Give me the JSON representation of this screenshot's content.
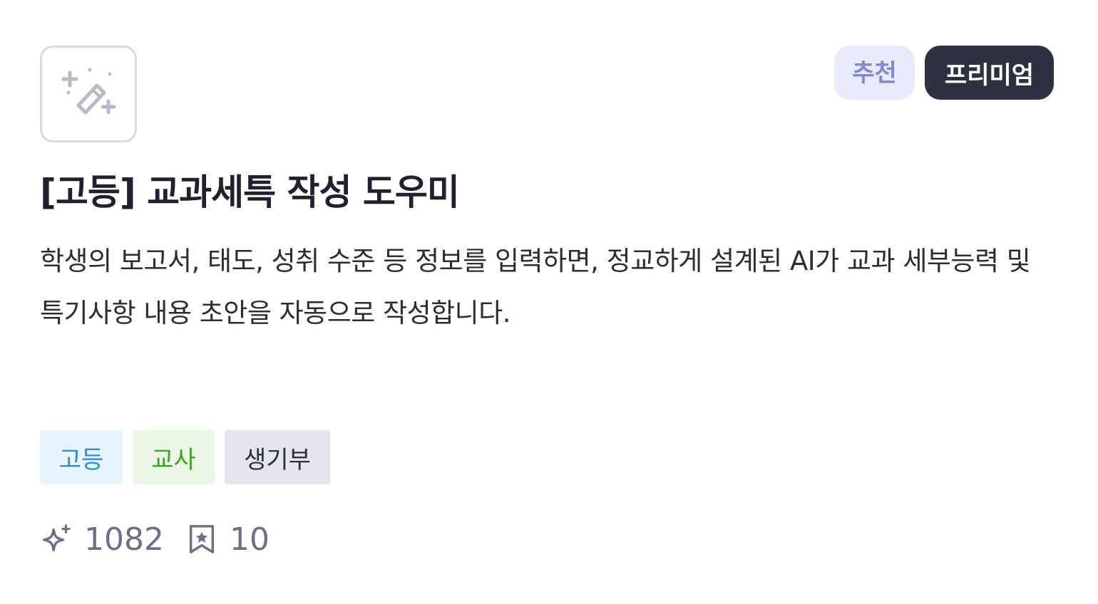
{
  "card": {
    "icon": "magic-wand-sparkles-icon",
    "badges": {
      "recommend": "추천",
      "premium": "프리미엄"
    },
    "title": "[고등] 교과세특 작성 도우미",
    "description": "학생의 보고서, 태도, 성취 수준 등 정보를 입력하면, 정교하게 설계된 AI가 교과 세부능력 및 특기사항 내용 초안을 자동으로 작성합니다.",
    "tags": [
      "고등",
      "교사",
      "생기부"
    ],
    "stats": {
      "uses_icon": "sparkle-icon",
      "uses": "1082",
      "bookmarks_icon": "bookmark-star-icon",
      "bookmarks": "10"
    }
  },
  "colors": {
    "recommend_bg": "#e8ebfb",
    "recommend_text": "#7f86dc",
    "premium_bg": "#2e3142",
    "tag_high_bg": "#e7f3fd",
    "tag_high_text": "#2b8ae6",
    "tag_teacher_bg": "#eaf7e6",
    "tag_teacher_text": "#3fa51c",
    "tag_record_bg": "#e5e5ef",
    "stats_text": "#6b6f8a"
  }
}
